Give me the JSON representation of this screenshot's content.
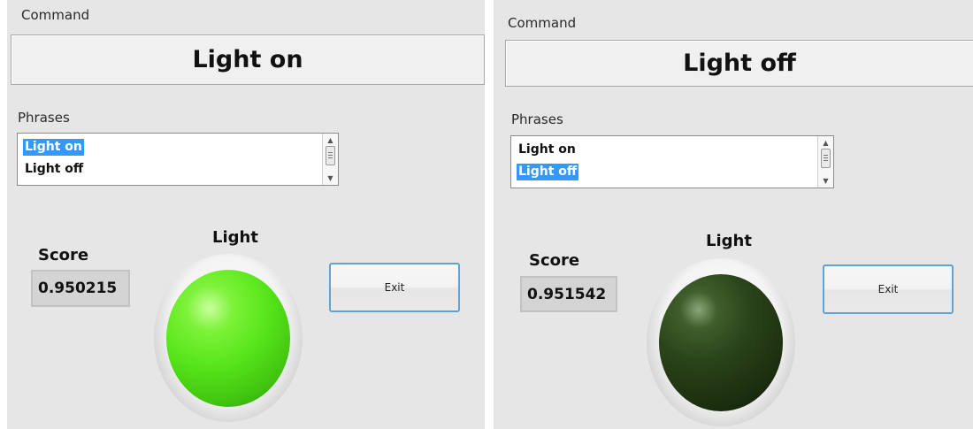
{
  "left": {
    "command_label": "Command",
    "command_value": "Light on",
    "phrases_label": "Phrases",
    "phrases": [
      {
        "label": "Light on",
        "selected": true
      },
      {
        "label": "Light off",
        "selected": false
      }
    ],
    "score_label": "Score",
    "score_value": "0.950215",
    "light_label": "Light",
    "light_state": "on",
    "exit_label": "Exit"
  },
  "right": {
    "command_label": "Command",
    "command_value": "Light off",
    "phrases_label": "Phrases",
    "phrases": [
      {
        "label": "Light on",
        "selected": false
      },
      {
        "label": "Light off",
        "selected": true
      }
    ],
    "score_label": "Score",
    "score_value": "0.951542",
    "light_label": "Light",
    "light_state": "off",
    "exit_label": "Exit"
  },
  "colors": {
    "panel_bg": "#e6e6e6",
    "selection": "#3399ff",
    "lamp_on": "#58e61a",
    "lamp_off": "#2a4319",
    "button_border": "#5aa6d8"
  },
  "icons": {
    "scroll_up": "▲",
    "scroll_down": "▼"
  }
}
